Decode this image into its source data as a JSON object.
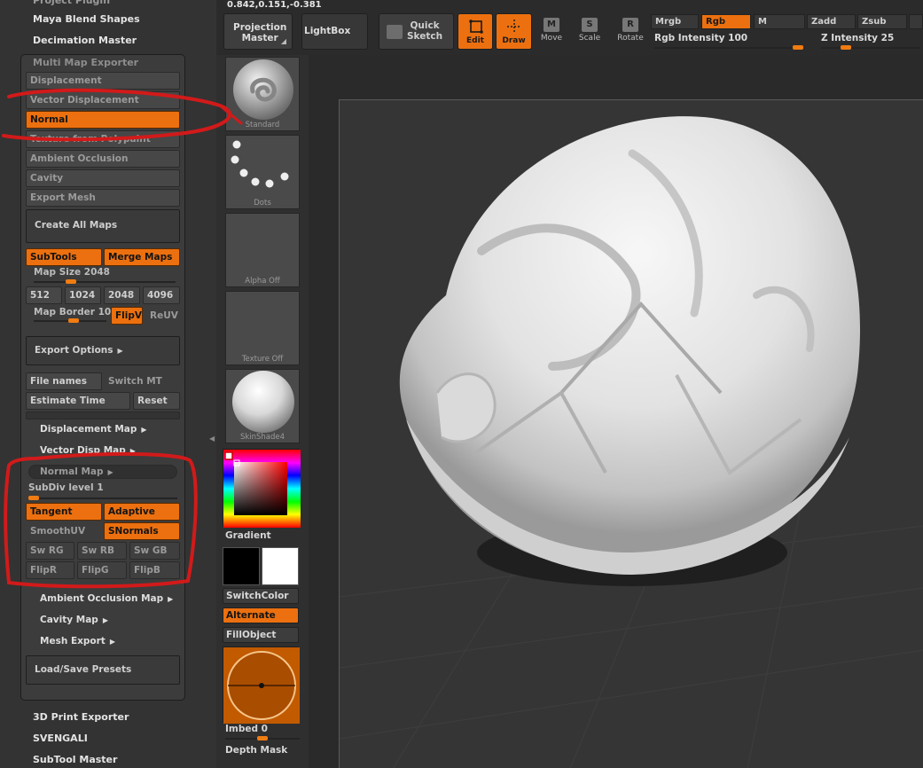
{
  "left_panel": {
    "top_plugins": [
      "Maya Blend Shapes",
      "Decimation Master"
    ],
    "multi_map_exporter": {
      "title": "Multi Map Exporter",
      "map_buttons": [
        "Displacement",
        "Vector Displacement",
        "Normal",
        "Texture from Polypaint",
        "Ambient Occlusion",
        "Cavity",
        "Export Mesh"
      ],
      "create_all_maps": "Create All Maps",
      "subtools": "SubTools",
      "merge_maps": "Merge Maps",
      "map_size_label": "Map Size",
      "map_size_value": "2048",
      "map_size_level": 0.26,
      "sizes": [
        "512",
        "1024",
        "2048",
        "4096"
      ],
      "map_border_label": "Map Border",
      "map_border_value": "10",
      "map_border_level": 0.55,
      "flipv": "FlipV",
      "reuv": "ReUV",
      "export_options": "Export Options",
      "file_names": "File names",
      "switch_mt": "Switch MT",
      "estimate_time": "Estimate Time",
      "reset": "Reset",
      "displacement_map": "Displacement Map",
      "vector_disp_map": "Vector Disp Map",
      "normal_map": "Normal Map",
      "subdiv_level_label": "SubDiv level",
      "subdiv_level_value": "1",
      "subdiv_level_level": 0.0,
      "tangent": "Tangent",
      "adaptive": "Adaptive",
      "smoothuv": "SmoothUV",
      "snormals": "SNormals",
      "swaps": [
        "Sw RG",
        "Sw RB",
        "Sw GB"
      ],
      "flips": [
        "FlipR",
        "FlipG",
        "FlipB"
      ],
      "ambient_occlusion_map": "Ambient Occlusion Map",
      "cavity_map": "Cavity Map",
      "mesh_export": "Mesh Export",
      "load_save_presets": "Load/Save Presets"
    },
    "bottom_plugins": [
      "3D Print Exporter",
      "SVENGALI",
      "SubTool Master"
    ]
  },
  "palette": {
    "brushes": [
      {
        "name": "Standard",
        "icon": "standard-brush-icon"
      },
      {
        "name": "Dots",
        "icon": "dots-stroke-icon"
      },
      {
        "name": "Alpha Off",
        "icon": "alpha-off-icon"
      },
      {
        "name": "Texture Off",
        "icon": "texture-off-icon"
      },
      {
        "name": "SkinShade4",
        "icon": "skinshade-material-icon"
      }
    ],
    "gradient": "Gradient",
    "switch_color": "SwitchColor",
    "alternate": "Alternate",
    "fill_object": "FillObject",
    "imbed_label": "Imbed",
    "imbed_value": "0",
    "imbed_level": 0.5,
    "depth_mask": "Depth Mask",
    "colors": {
      "main": "#000000",
      "secondary": "#ffffff",
      "accent": "#ec700f"
    }
  },
  "toolbar": {
    "coords": "0.842,0.151,-0.381",
    "projection_master": [
      "Projection",
      "Master"
    ],
    "lightbox": "LightBox",
    "quick_sketch": [
      "Quick",
      "Sketch"
    ],
    "edit": "Edit",
    "draw": "Draw",
    "move": "Move",
    "scale": "Scale",
    "rotate": "Rotate",
    "mrgb": "Mrgb",
    "rgb": "Rgb",
    "m": "M",
    "zadd": "Zadd",
    "zsub": "Zsub",
    "rgb_intensity_label": "Rgb Intensity",
    "rgb_intensity_value": "100",
    "z_intensity_label": "Z Intensity",
    "z_intensity_value": "25",
    "rgb_intensity_level": 1.0,
    "z_intensity_level": 0.25
  }
}
